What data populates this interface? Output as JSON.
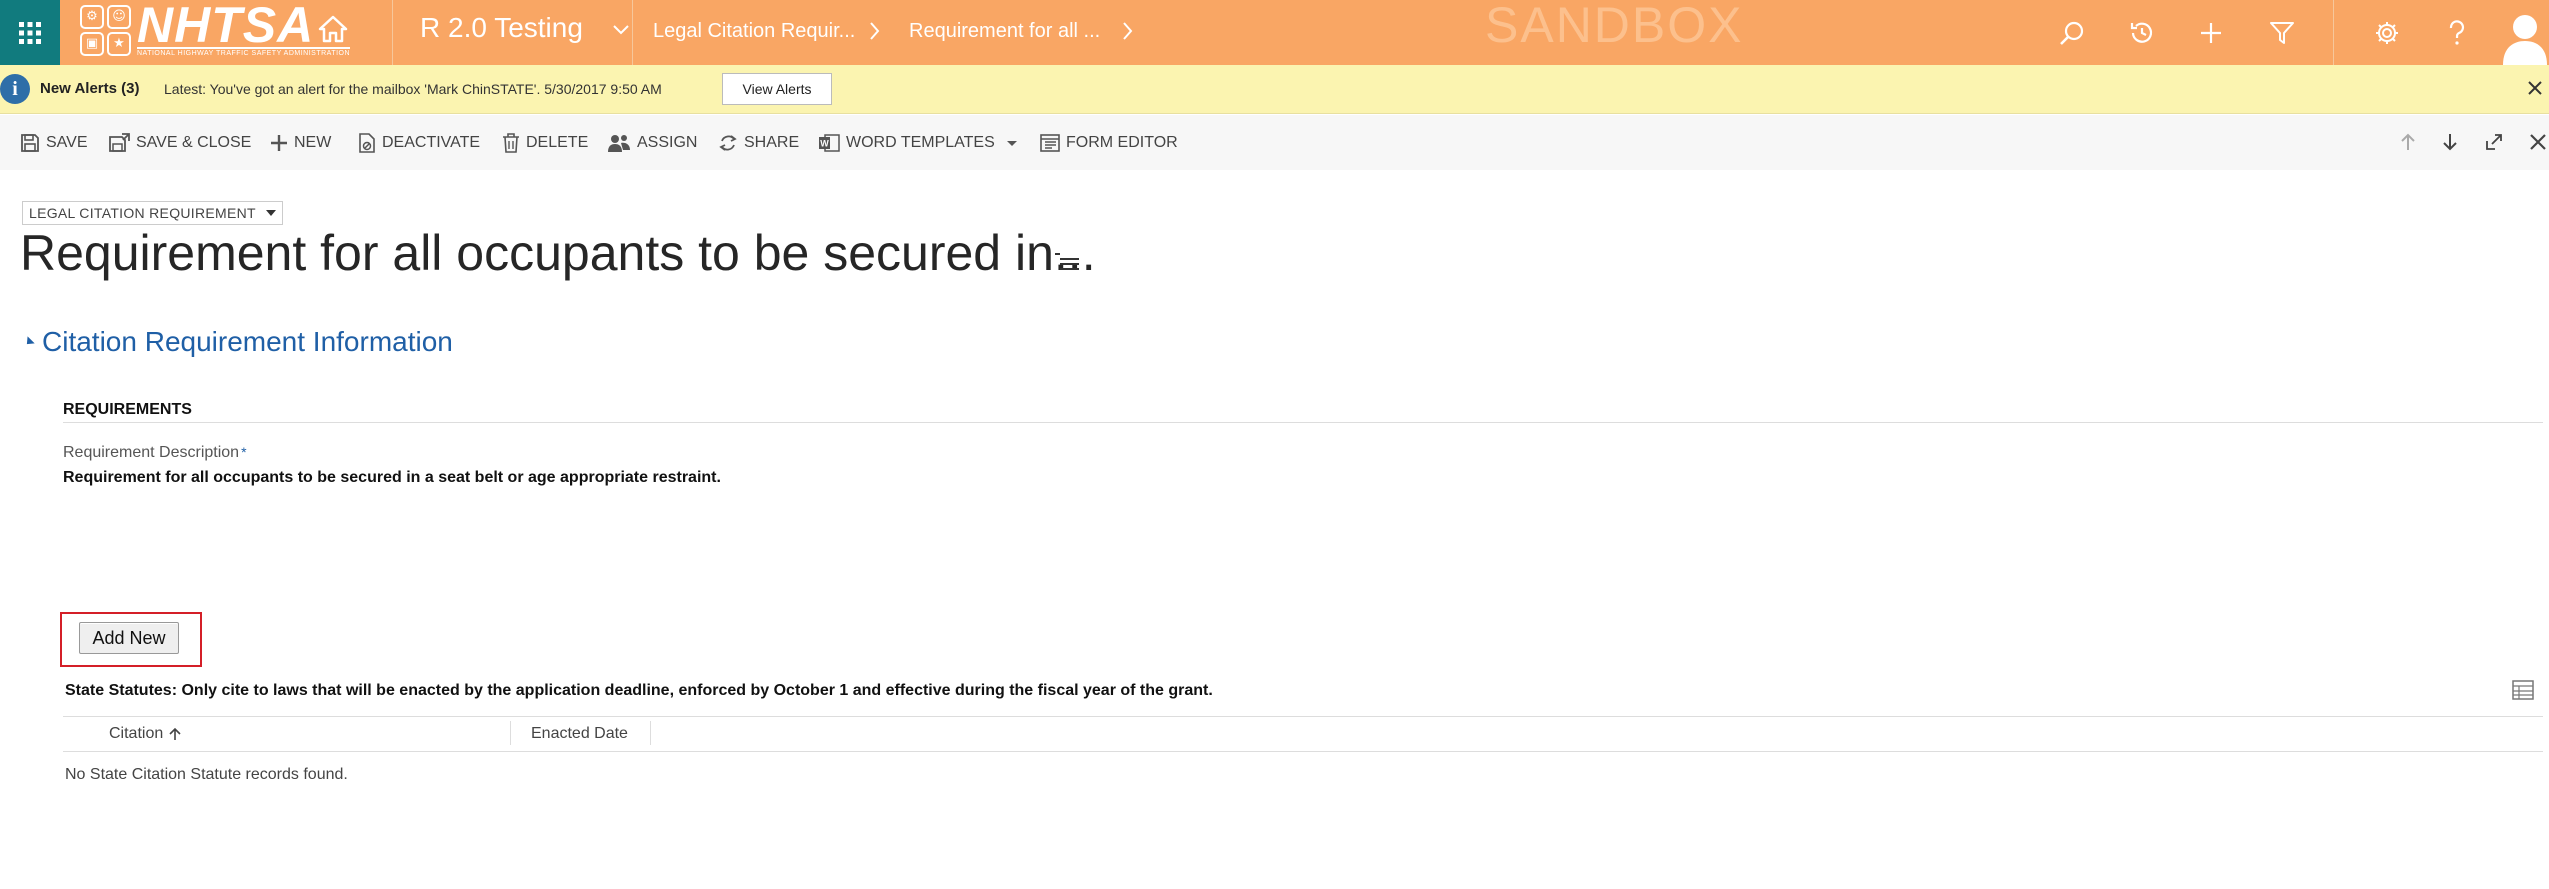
{
  "nav": {
    "logo_text": "NHTSA",
    "logo_subtext": "NATIONAL HIGHWAY TRAFFIC SAFETY ADMINISTRATION",
    "area": "R 2.0 Testing",
    "crumb1": "Legal Citation Requir...",
    "crumb2": "Requirement for all ...",
    "environment": "SANDBOX",
    "icons": [
      "app-launcher-icon",
      "home-icon",
      "search-icon",
      "recent-icon",
      "create-icon",
      "advanced-find-icon",
      "settings-icon",
      "help-icon",
      "user-icon"
    ],
    "colors": {
      "bar": "#f9a664",
      "launcher": "#117b7e"
    }
  },
  "alert": {
    "title": "New Alerts (3)",
    "message": "Latest: You've got an alert for the mailbox 'Mark ChinSTATE'. 5/30/2017 9:50 AM",
    "button": "View Alerts"
  },
  "commands": {
    "save": "SAVE",
    "save_close": "SAVE & CLOSE",
    "new": "NEW",
    "deactivate": "DEACTIVATE",
    "delete": "DELETE",
    "assign": "ASSIGN",
    "share": "SHARE",
    "word_templates": "WORD TEMPLATES",
    "form_editor": "FORM EDITOR"
  },
  "form": {
    "entity": "LEGAL CITATION REQUIREMENT",
    "title": "Requirement for all occupants to be secured in...",
    "section": "Citation Requirement Information",
    "subsection": "REQUIREMENTS",
    "field_label": "Requirement Description",
    "required_mark": "*",
    "field_value": "Requirement for all occupants to be secured in a seat belt or age appropriate restraint.",
    "add_new": "Add New",
    "statute_note": "State Statutes: Only cite to laws that will be enacted by the application deadline, enforced by October 1 and effective during the fiscal year of the grant.",
    "columns": [
      "Citation",
      "Enacted Date"
    ],
    "empty_message": "No State Citation Statute records found.",
    "highlight_color": "#d41f28",
    "accent_color": "#1f5fa6"
  }
}
